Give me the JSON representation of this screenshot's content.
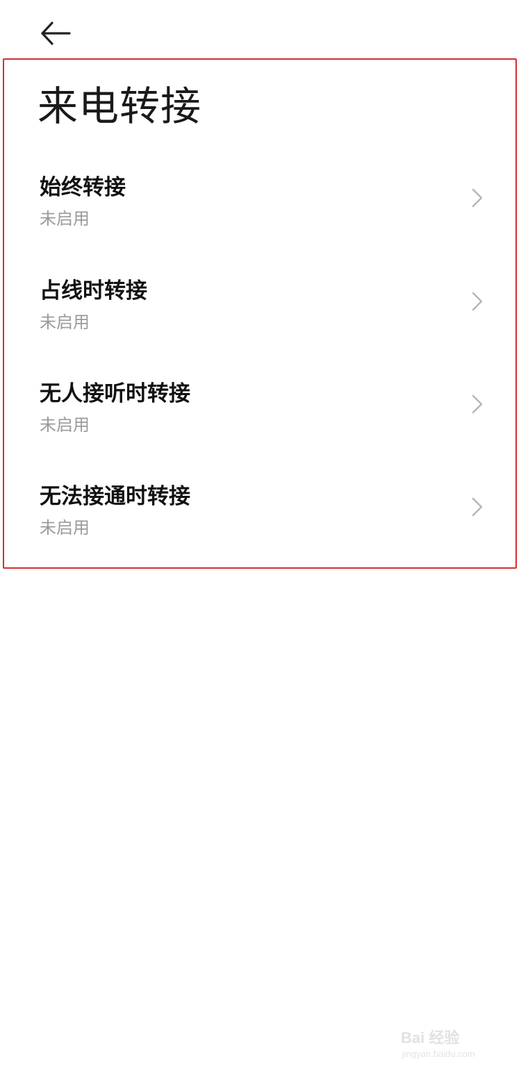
{
  "header": {
    "back_icon": "arrow-left-icon"
  },
  "page": {
    "title": "来电转接"
  },
  "colors": {
    "highlight_border": "#d12f2f",
    "title_text": "#111111",
    "status_text": "#9a9a9a",
    "chevron": "#b5b5b5"
  },
  "forwarding_options": [
    {
      "title": "始终转接",
      "status": "未启用",
      "icon": "chevron-right-icon"
    },
    {
      "title": "占线时转接",
      "status": "未启用",
      "icon": "chevron-right-icon"
    },
    {
      "title": "无人接听时转接",
      "status": "未启用",
      "icon": "chevron-right-icon"
    },
    {
      "title": "无法接通时转接",
      "status": "未启用",
      "icon": "chevron-right-icon"
    }
  ],
  "watermark": {
    "label": "Bai 经验",
    "url_text": "jingyan.baidu.com"
  }
}
